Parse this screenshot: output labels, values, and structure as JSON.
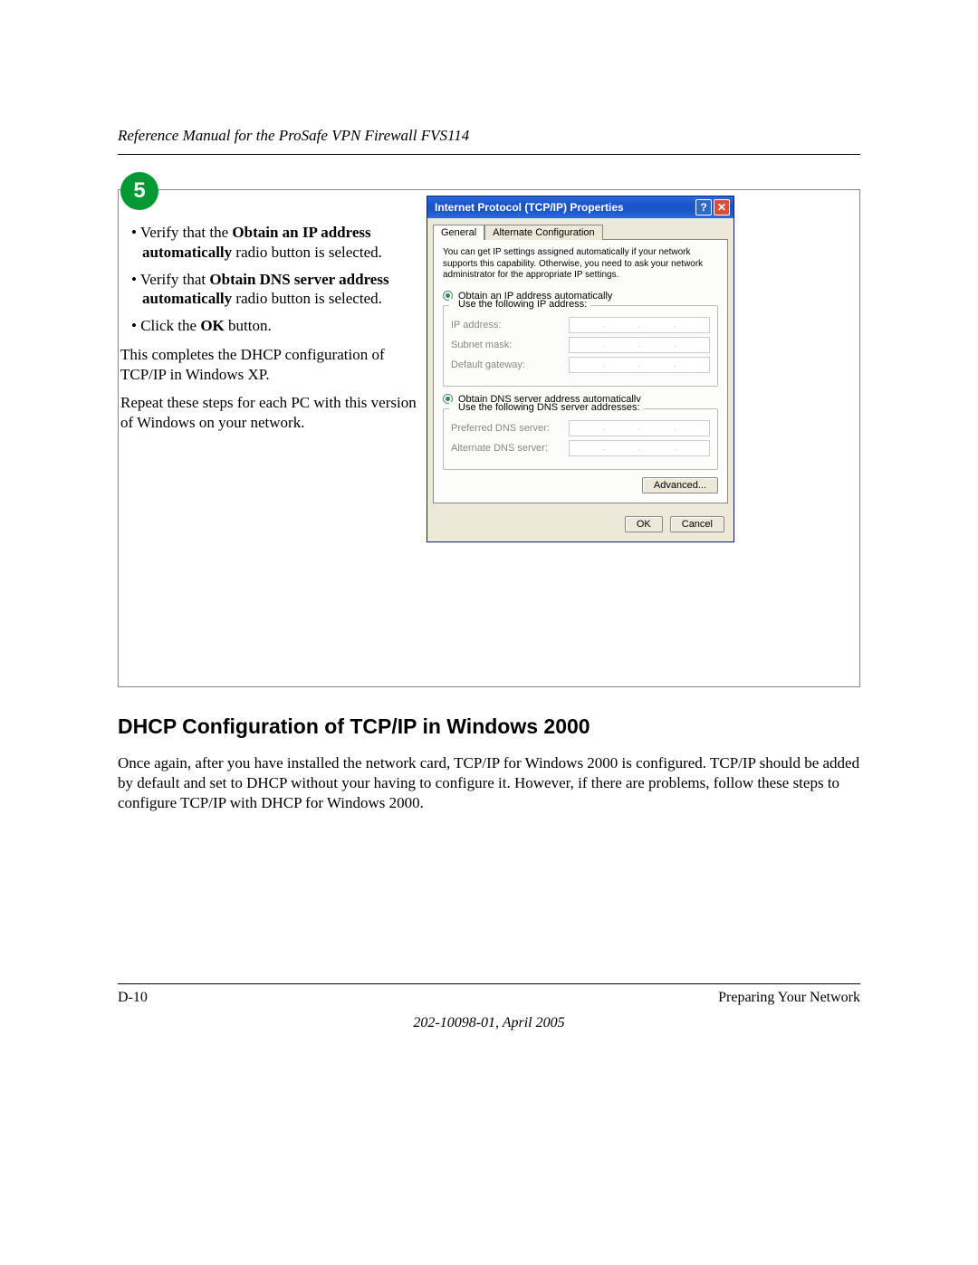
{
  "header": {
    "title": "Reference Manual for the ProSafe VPN Firewall FVS114"
  },
  "step": {
    "number": "5"
  },
  "instructions": {
    "bullet1_pre": "Verify that the ",
    "bullet1_bold": "Obtain an IP address automatically",
    "bullet1_post": " radio button is selected.",
    "bullet2_pre": "Verify that ",
    "bullet2_bold": "Obtain DNS server address automatically",
    "bullet2_post": " radio button is selected.",
    "bullet3_pre": "Click the ",
    "bullet3_bold": "OK",
    "bullet3_post": " button.",
    "para1": "This completes the DHCP configuration of TCP/IP in Windows XP.",
    "para2": "Repeat these steps for each PC with this version of Windows on your network."
  },
  "dialog": {
    "title": "Internet Protocol (TCP/IP) Properties",
    "help": "?",
    "close": "✕",
    "tabs": {
      "general": "General",
      "alt": "Alternate Configuration"
    },
    "intro": "You can get IP settings assigned automatically if your network supports this capability. Otherwise, you need to ask your network administrator for the appropriate IP settings.",
    "radio_auto_ip": "Obtain an IP address automatically",
    "radio_static_ip": "Use the following IP address:",
    "ip_label": "IP address:",
    "subnet_label": "Subnet mask:",
    "gateway_label": "Default gateway:",
    "radio_auto_dns": "Obtain DNS server address automatically",
    "radio_static_dns": "Use the following DNS server addresses:",
    "pref_dns": "Preferred DNS server:",
    "alt_dns": "Alternate DNS server:",
    "advanced": "Advanced...",
    "ok": "OK",
    "cancel": "Cancel"
  },
  "section": {
    "title": "DHCP Configuration of TCP/IP in Windows 2000",
    "body": "Once again, after you have installed the network card, TCP/IP for Windows 2000 is configured. TCP/IP should be added by default and set to DHCP without your having to configure it. However, if there are problems, follow these steps to configure TCP/IP with DHCP for Windows 2000."
  },
  "footer": {
    "page": "D-10",
    "section": "Preparing Your Network",
    "docid": "202-10098-01, April 2005"
  }
}
